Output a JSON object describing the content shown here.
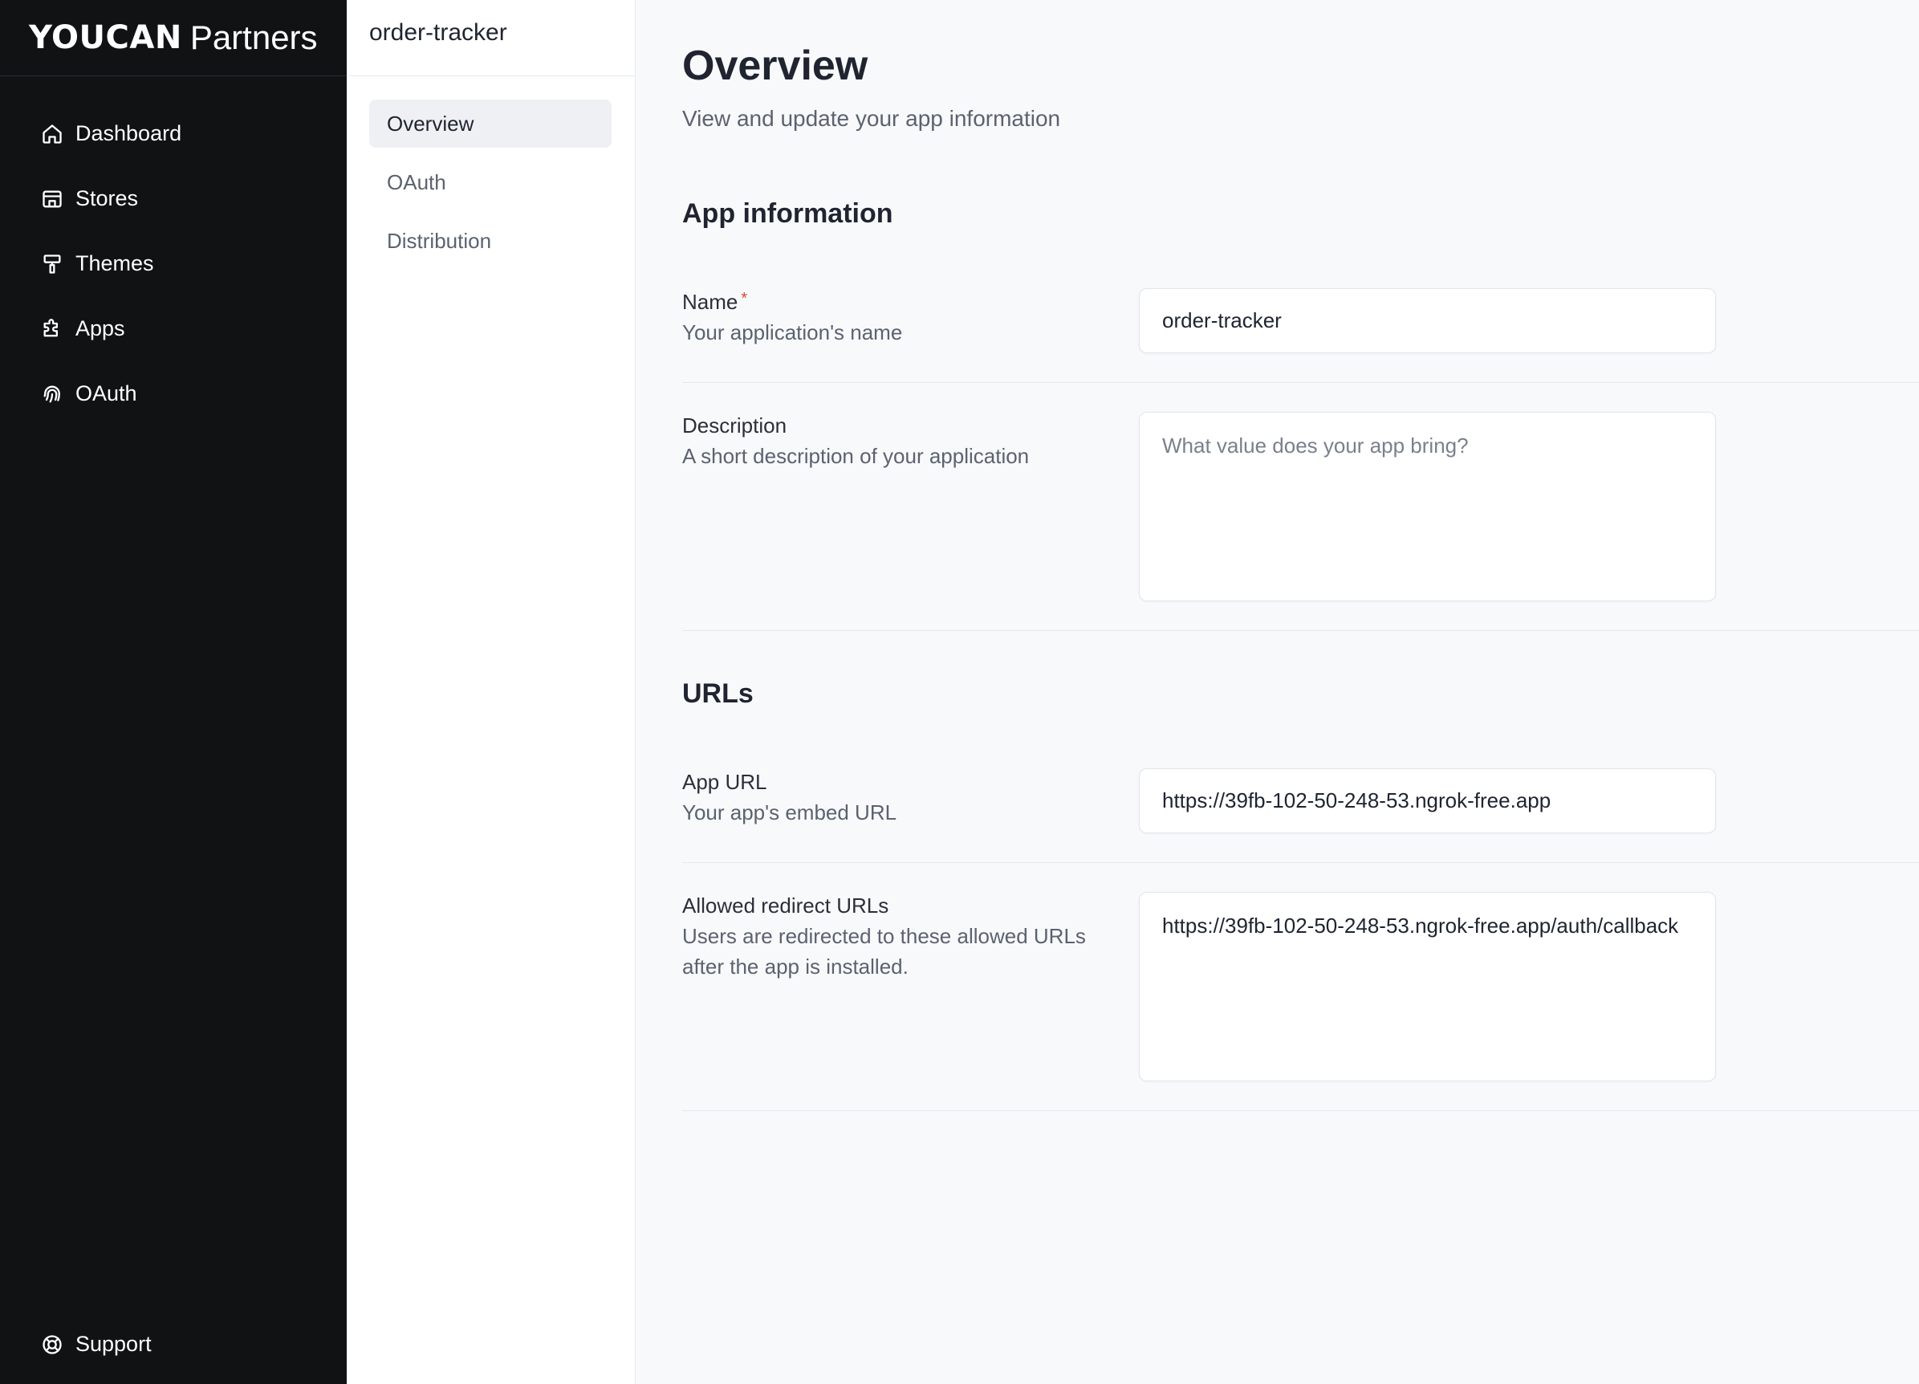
{
  "brand": {
    "wordmark": "YOUCAN",
    "suffix": "Partners"
  },
  "sidebar": {
    "items": [
      {
        "label": "Dashboard",
        "icon": "home-icon"
      },
      {
        "label": "Stores",
        "icon": "store-icon"
      },
      {
        "label": "Themes",
        "icon": "paint-roller-icon"
      },
      {
        "label": "Apps",
        "icon": "puzzle-icon"
      },
      {
        "label": "OAuth",
        "icon": "fingerprint-icon"
      }
    ],
    "support": {
      "label": "Support",
      "icon": "lifebuoy-icon"
    }
  },
  "app_panel": {
    "title": "order-tracker",
    "items": [
      {
        "label": "Overview",
        "active": true
      },
      {
        "label": "OAuth",
        "active": false
      },
      {
        "label": "Distribution",
        "active": false
      }
    ]
  },
  "page": {
    "title": "Overview",
    "subtitle": "View and update your app information"
  },
  "app_info": {
    "section_title": "App information",
    "name": {
      "label": "Name",
      "required_marker": "*",
      "help": "Your application's name",
      "value": "order-tracker"
    },
    "description": {
      "label": "Description",
      "help": "A short description of your application",
      "value": "",
      "placeholder": "What value does your app bring?"
    }
  },
  "urls": {
    "section_title": "URLs",
    "app_url": {
      "label": "App URL",
      "help": "Your app's embed URL",
      "value": "https://39fb-102-50-248-53.ngrok-free.app"
    },
    "redirect_urls": {
      "label": "Allowed redirect URLs",
      "help": "Users are redirected to these allowed URLs after the app is installed.",
      "value": "https://39fb-102-50-248-53.ngrok-free.app/auth/callback"
    }
  },
  "colors": {
    "sidebar_bg": "#111214",
    "page_bg": "#f8f9fb",
    "required": "#e0453b"
  }
}
